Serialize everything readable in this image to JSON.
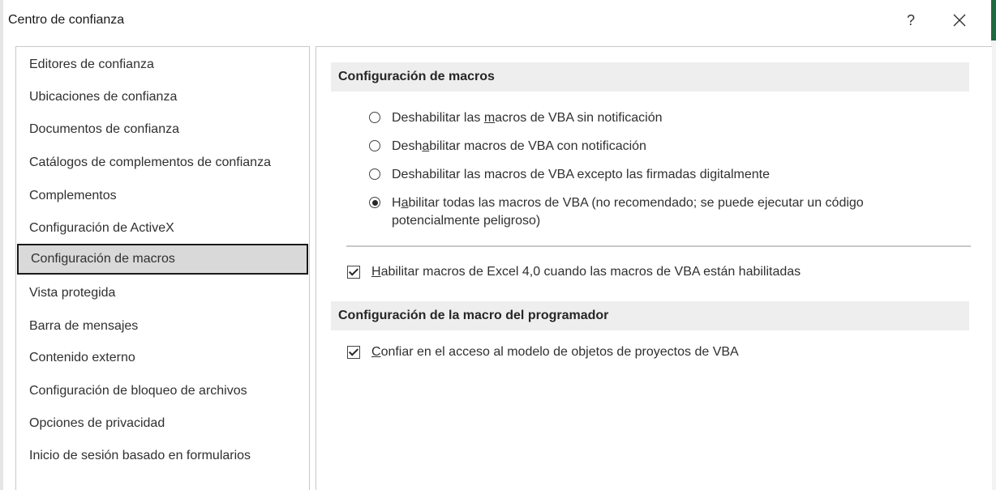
{
  "window": {
    "title": "Centro de confianza",
    "help_label": "?"
  },
  "sidebar": {
    "items": [
      {
        "label": "Editores de confianza",
        "selected": false
      },
      {
        "label": "Ubicaciones de confianza",
        "selected": false
      },
      {
        "label": "Documentos de confianza",
        "selected": false
      },
      {
        "label": "Catálogos de complementos de confianza",
        "selected": false
      },
      {
        "label": "Complementos",
        "selected": false
      },
      {
        "label": "Configuración de ActiveX",
        "selected": false
      },
      {
        "label": "Configuración de macros",
        "selected": true
      },
      {
        "label": "Vista protegida",
        "selected": false
      },
      {
        "label": "Barra de mensajes",
        "selected": false
      },
      {
        "label": "Contenido externo",
        "selected": false
      },
      {
        "label": "Configuración de bloqueo de archivos",
        "selected": false
      },
      {
        "label": "Opciones de privacidad",
        "selected": false
      },
      {
        "label": "Inicio de sesión basado en formularios",
        "selected": false
      }
    ]
  },
  "main": {
    "macro_settings": {
      "header": "Configuración de macros",
      "options": [
        {
          "pre": "Deshabilitar las ",
          "accel": "m",
          "post": "acros de VBA sin notificación",
          "line2": "",
          "checked": false
        },
        {
          "pre": "Desh",
          "accel": "a",
          "post": "bilitar macros de VBA con notificación",
          "line2": "",
          "checked": false
        },
        {
          "pre": "Deshabilitar las macros de VBA excepto las firmadas di",
          "accel": "g",
          "post": "italmente",
          "line2": "",
          "checked": false
        },
        {
          "pre": "H",
          "accel": "a",
          "post": "bilitar todas las macros de VBA (no recomendado; se puede ejecutar un código",
          "line2": "potencialmente peligroso)",
          "checked": true
        }
      ],
      "excel4_checkbox": {
        "accel": "H",
        "post": "abilitar macros de Excel 4,0 cuando las macros de VBA están habilitadas",
        "checked": true
      }
    },
    "developer_settings": {
      "header": "Configuración de la macro del programador",
      "trust_checkbox": {
        "accel": "C",
        "post": "onfiar en el acceso al modelo de objetos de proyectos de VBA",
        "checked": true
      }
    }
  }
}
